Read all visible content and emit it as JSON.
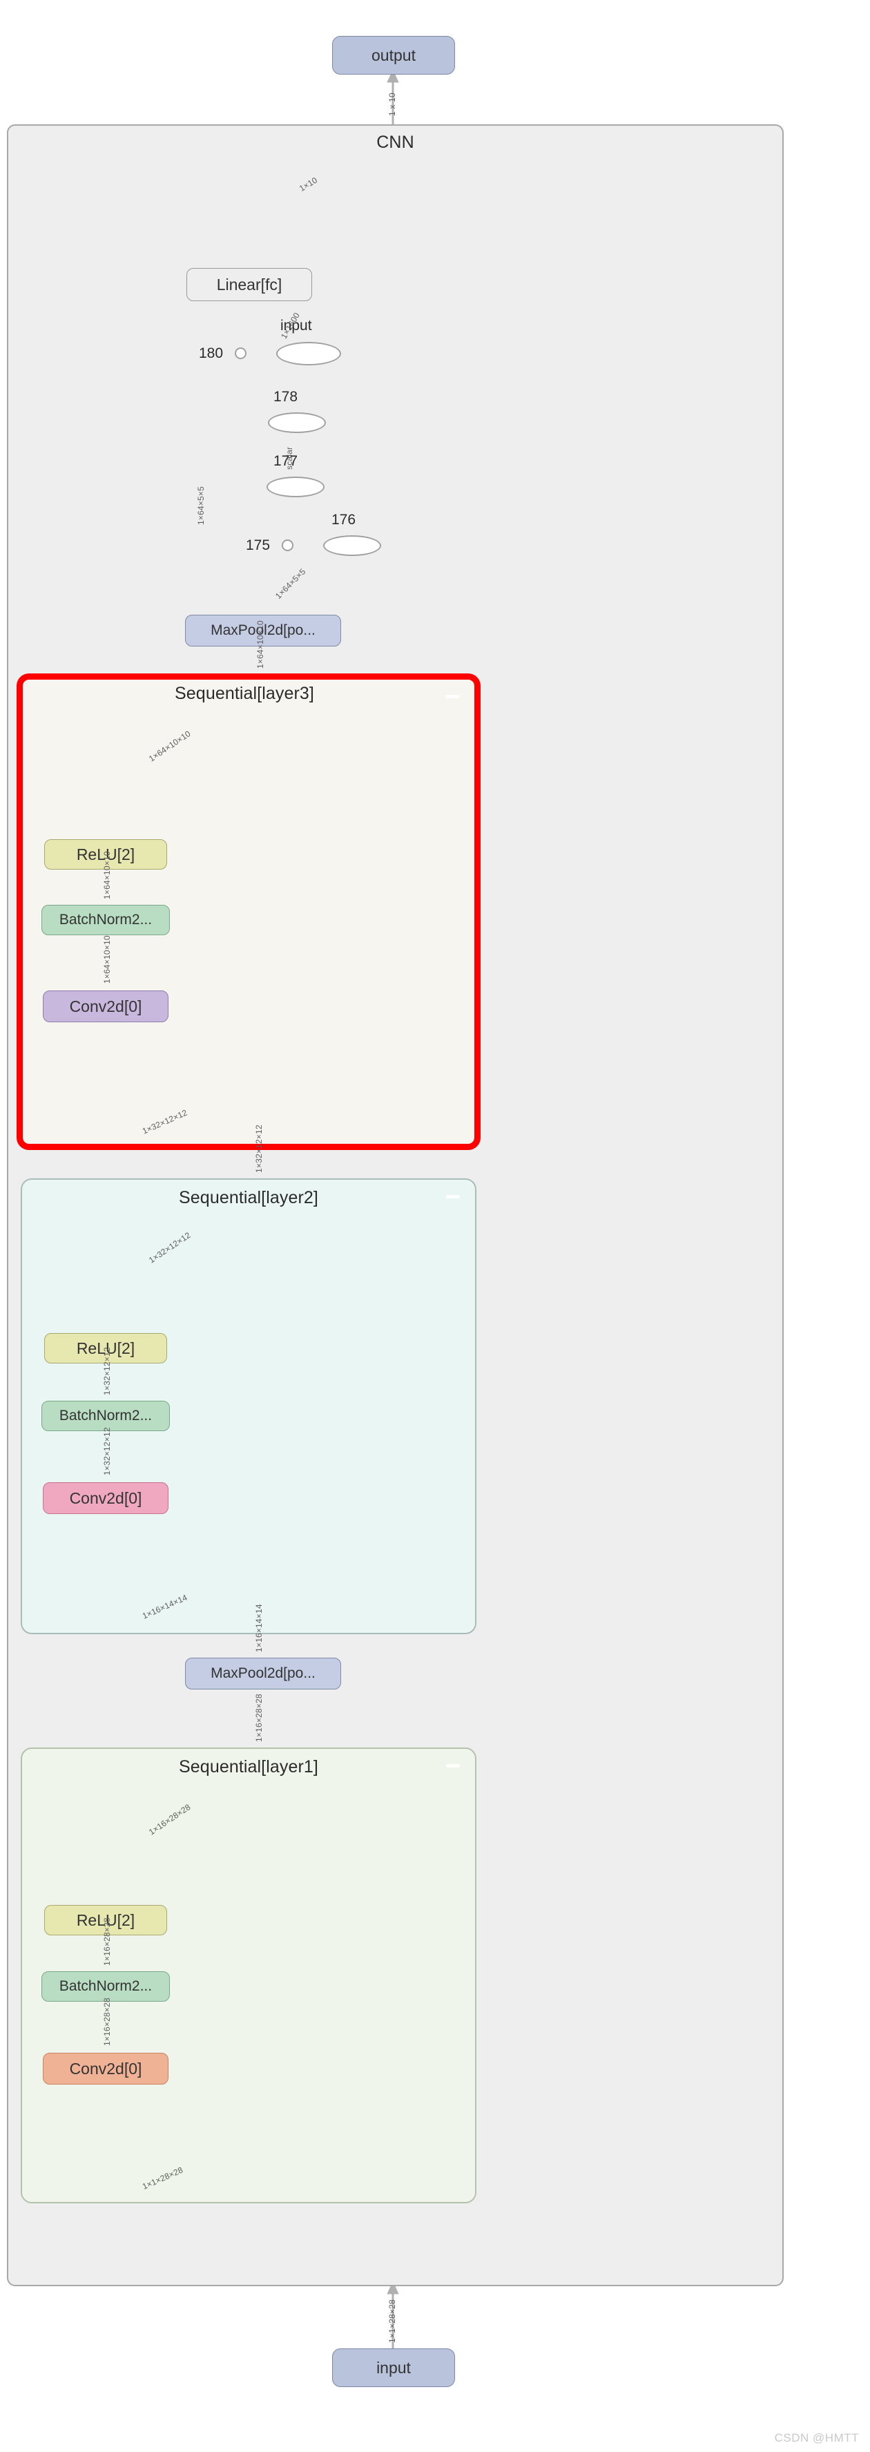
{
  "diagram": {
    "title": "CNN",
    "watermark": "CSDN @HMTT",
    "highlight_color": "#ff0000",
    "io_nodes": {
      "output": "output",
      "input": "input"
    },
    "clusters": [
      {
        "id": "cnn",
        "label": "CNN",
        "fill": "#eeeeee",
        "stroke": "#a8a8a8",
        "highlighted": false
      },
      {
        "id": "layer3",
        "label": "Sequential[layer3]",
        "fill": "#f7f5ef",
        "stroke": "#ff0000",
        "highlighted": true
      },
      {
        "id": "layer2",
        "label": "Sequential[layer2]",
        "fill": "#eaf6f3",
        "stroke": "#a8bcba",
        "highlighted": false
      },
      {
        "id": "layer1",
        "label": "Sequential[layer1]",
        "fill": "#eff5ea",
        "stroke": "#b4c2ad",
        "highlighted": false
      }
    ],
    "nodes": {
      "output": "output",
      "linear_fc": "Linear[fc]",
      "maxpool_top": "MaxPool2d[po...",
      "maxpool_mid": "MaxPool2d[po...",
      "layer3_relu": "ReLU[2]",
      "layer3_bn": "BatchNorm2...",
      "layer3_conv": "Conv2d[0]",
      "layer2_relu": "ReLU[2]",
      "layer2_bn": "BatchNorm2...",
      "layer2_conv": "Conv2d[0]",
      "layer1_relu": "ReLU[2]",
      "layer1_bn": "BatchNorm2...",
      "layer1_conv": "Conv2d[0]",
      "input": "input"
    },
    "op_nodes": [
      {
        "id": "op_input",
        "label": "input"
      },
      {
        "id": "op_178",
        "label": "178"
      },
      {
        "id": "op_177",
        "label": "177"
      },
      {
        "id": "op_176",
        "label": "176"
      }
    ],
    "const_nodes": [
      {
        "id": "c180",
        "label": "180"
      },
      {
        "id": "c175",
        "label": "175"
      }
    ],
    "edge_labels": {
      "output_to_cnn": "1 x 10",
      "fc_to_boundary": "1×10",
      "opinput_to_fc": "1×1600",
      "op178_to_opinput": "",
      "op177_to_op178": "scalar",
      "op176_to_op177": "",
      "pool_to_opinput": "1×64×5×5",
      "pool_to_op176": "1×64×5×5",
      "layer3_to_pool": "1×64×10×10",
      "layer3_relu_out": "1×64×10×10",
      "layer3_bn_to_relu": "1×64×10×10",
      "layer3_conv_to_bn": "1×64×10×10",
      "layer3_in": "1×32×12×12",
      "layer2_to_layer3": "1×32×12×12",
      "layer2_relu_out": "1×32×12×12",
      "layer2_bn_to_relu": "1×32×12×12",
      "layer2_conv_to_bn": "1×32×12×12",
      "layer2_in": "1×16×14×14",
      "pool_mid_out": "1×16×14×14",
      "pool_mid_in": "1×16×28×28",
      "layer1_out": "1×16×28×28",
      "layer1_relu_out": "1×16×28×28",
      "layer1_bn_to_relu": "1×16×28×28",
      "layer1_conv_to_bn": "1×16×28×28",
      "layer1_in": "1×1×28×28",
      "input_to_cnn": "1×1×28×28"
    },
    "node_colors": {
      "io": "#b9c3dc",
      "pool": "#c4cde3",
      "relu": "#e7e8b0",
      "batchnorm": "#b9ddc3",
      "conv_layer3": "#c9b8de",
      "conv_layer2": "#f0a8c0",
      "conv_layer1": "#f0b294"
    }
  }
}
